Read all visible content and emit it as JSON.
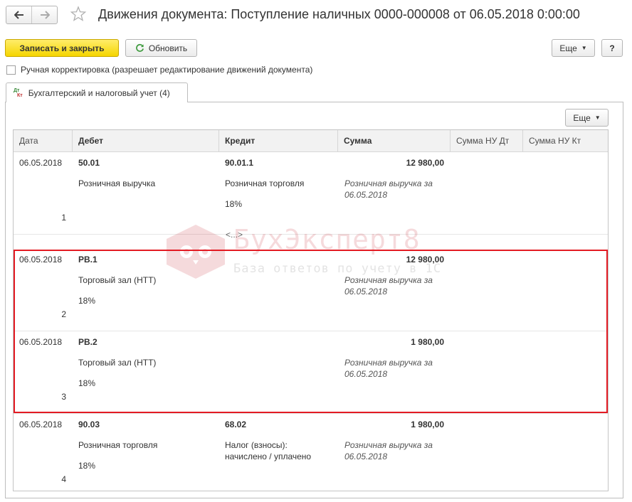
{
  "window": {
    "title": "Движения документа: Поступление наличных 0000-000008 от 06.05.2018 0:00:00"
  },
  "toolbar": {
    "save_close": "Записать и закрыть",
    "refresh": "Обновить",
    "more": "Еще",
    "help": "?"
  },
  "manual_edit": {
    "label": "Ручная корректировка (разрешает редактирование движений документа)",
    "checked": false
  },
  "tabs": [
    {
      "label": "Бухгалтерский и налоговый учет (4)",
      "icon": "dt-kt-icon",
      "icon_dt": "Дт",
      "icon_kt": "Кт"
    }
  ],
  "table_toolbar": {
    "more": "Еще"
  },
  "table": {
    "columns": [
      "Дата",
      "Дебет",
      "Кредит",
      "Сумма",
      "Сумма НУ Дт",
      "Сумма НУ Кт"
    ],
    "rows": [
      {
        "date": "06.05.2018",
        "n": "1",
        "debit": {
          "account": "50.01",
          "sub1": "Розничная выручка",
          "sub2": ""
        },
        "credit": {
          "account": "90.01.1",
          "sub1": "Розничная торговля",
          "sub2": "18%"
        },
        "sum": "12 980,00",
        "content1": "Розничная выручка за",
        "content2": "06.05.2018"
      },
      {
        "date": "06.05.2018",
        "n": "2",
        "debit": {
          "account": "РВ.1",
          "sub1": "Торговый зал (НТТ)",
          "sub2": "18%"
        },
        "credit": {
          "account": "",
          "sub1": "",
          "sub2": ""
        },
        "sum": "12 980,00",
        "content1": "Розничная выручка за",
        "content2": "06.05.2018"
      },
      {
        "date": "06.05.2018",
        "n": "3",
        "debit": {
          "account": "РВ.2",
          "sub1": "Торговый зал (НТТ)",
          "sub2": "18%"
        },
        "credit": {
          "account": "",
          "sub1": "",
          "sub2": ""
        },
        "sum": "1 980,00",
        "content1": "Розничная выручка за",
        "content2": "06.05.2018"
      },
      {
        "date": "06.05.2018",
        "n": "4",
        "debit": {
          "account": "90.03",
          "sub1": "Розничная торговля",
          "sub2": "18%"
        },
        "credit": {
          "account": "68.02",
          "sub1": "Налог (взносы):",
          "sub2": "начислено / уплачено"
        },
        "sum": "1 980,00",
        "content1": "Розничная выручка за",
        "content2": "06.05.2018"
      }
    ],
    "placeholder": "<...>"
  },
  "watermark": {
    "title": "БухЭксперт8",
    "subtitle": "База ответов по учету в 1С"
  },
  "colors": {
    "accent": "#f5d500",
    "highlight": "#e31b23",
    "refresh_icon": "#3c9a3c"
  }
}
